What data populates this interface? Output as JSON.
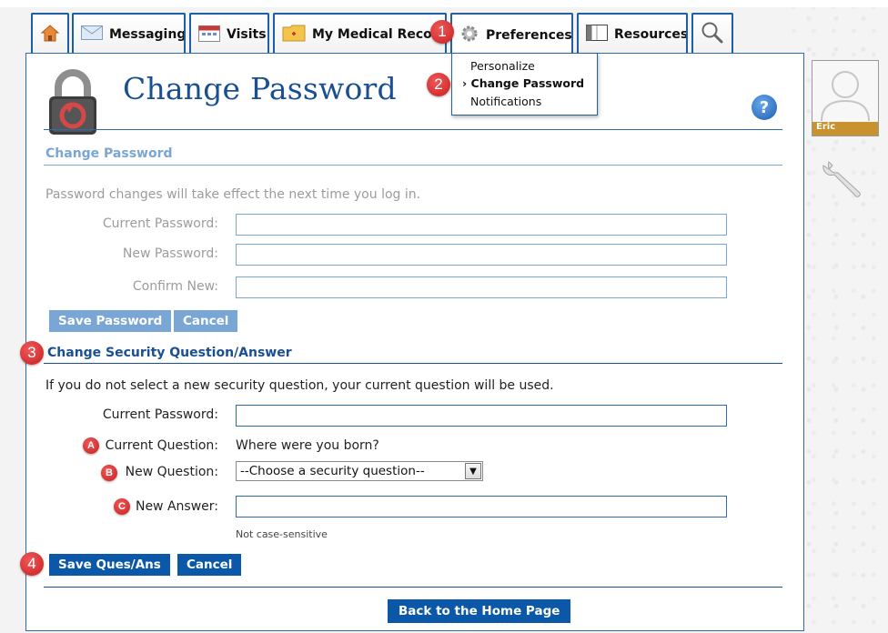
{
  "tabs": {
    "messaging": "Messaging",
    "visits": "Visits",
    "medical": "My Medical Reco",
    "preferences": "Preferences",
    "resources": "Resources"
  },
  "dropdown": {
    "items": [
      "Personalize",
      "Change Password",
      "Notifications"
    ],
    "active_prefix": "›"
  },
  "page": {
    "title": "Change Password"
  },
  "password_section": {
    "title": "Change Password",
    "info": "Password changes will take effect the next time you log in.",
    "current_label": "Current Password:",
    "new_label": "New Password:",
    "confirm_label": "Confirm New:",
    "save": "Save Password",
    "cancel": "Cancel"
  },
  "security_section": {
    "title": "Change Security Question/Answer",
    "info": "If you do not select a new security question, your current question will be used.",
    "current_password_label": "Current Password:",
    "current_question_label": "Current Question:",
    "current_question_value": "Where were you born?",
    "new_question_label": "New Question:",
    "new_question_selected": "--Choose a security question--",
    "new_answer_label": "New Answer:",
    "hint": "Not case-sensitive",
    "save": "Save Ques/Ans",
    "cancel": "Cancel"
  },
  "back_button": "Back to the Home Page",
  "user": {
    "name": "Eric"
  },
  "help_glyph": "?",
  "markers": {
    "m1": "1",
    "m2": "2",
    "m3": "3",
    "m4": "4",
    "a": "A",
    "b": "B",
    "c": "C"
  },
  "colors": {
    "accent": "#1a4f93",
    "button": "#0b58a8",
    "button_faded": "#7aa6d6",
    "marker": "#d22626",
    "avatar_band": "#c8922e"
  },
  "icons": [
    "home-icon",
    "envelope-icon",
    "calendar-icon",
    "folder-icon",
    "gear-icon",
    "book-icon",
    "search-icon",
    "lock-icon",
    "help-icon",
    "wrench-icon",
    "user-silhouette-icon"
  ]
}
